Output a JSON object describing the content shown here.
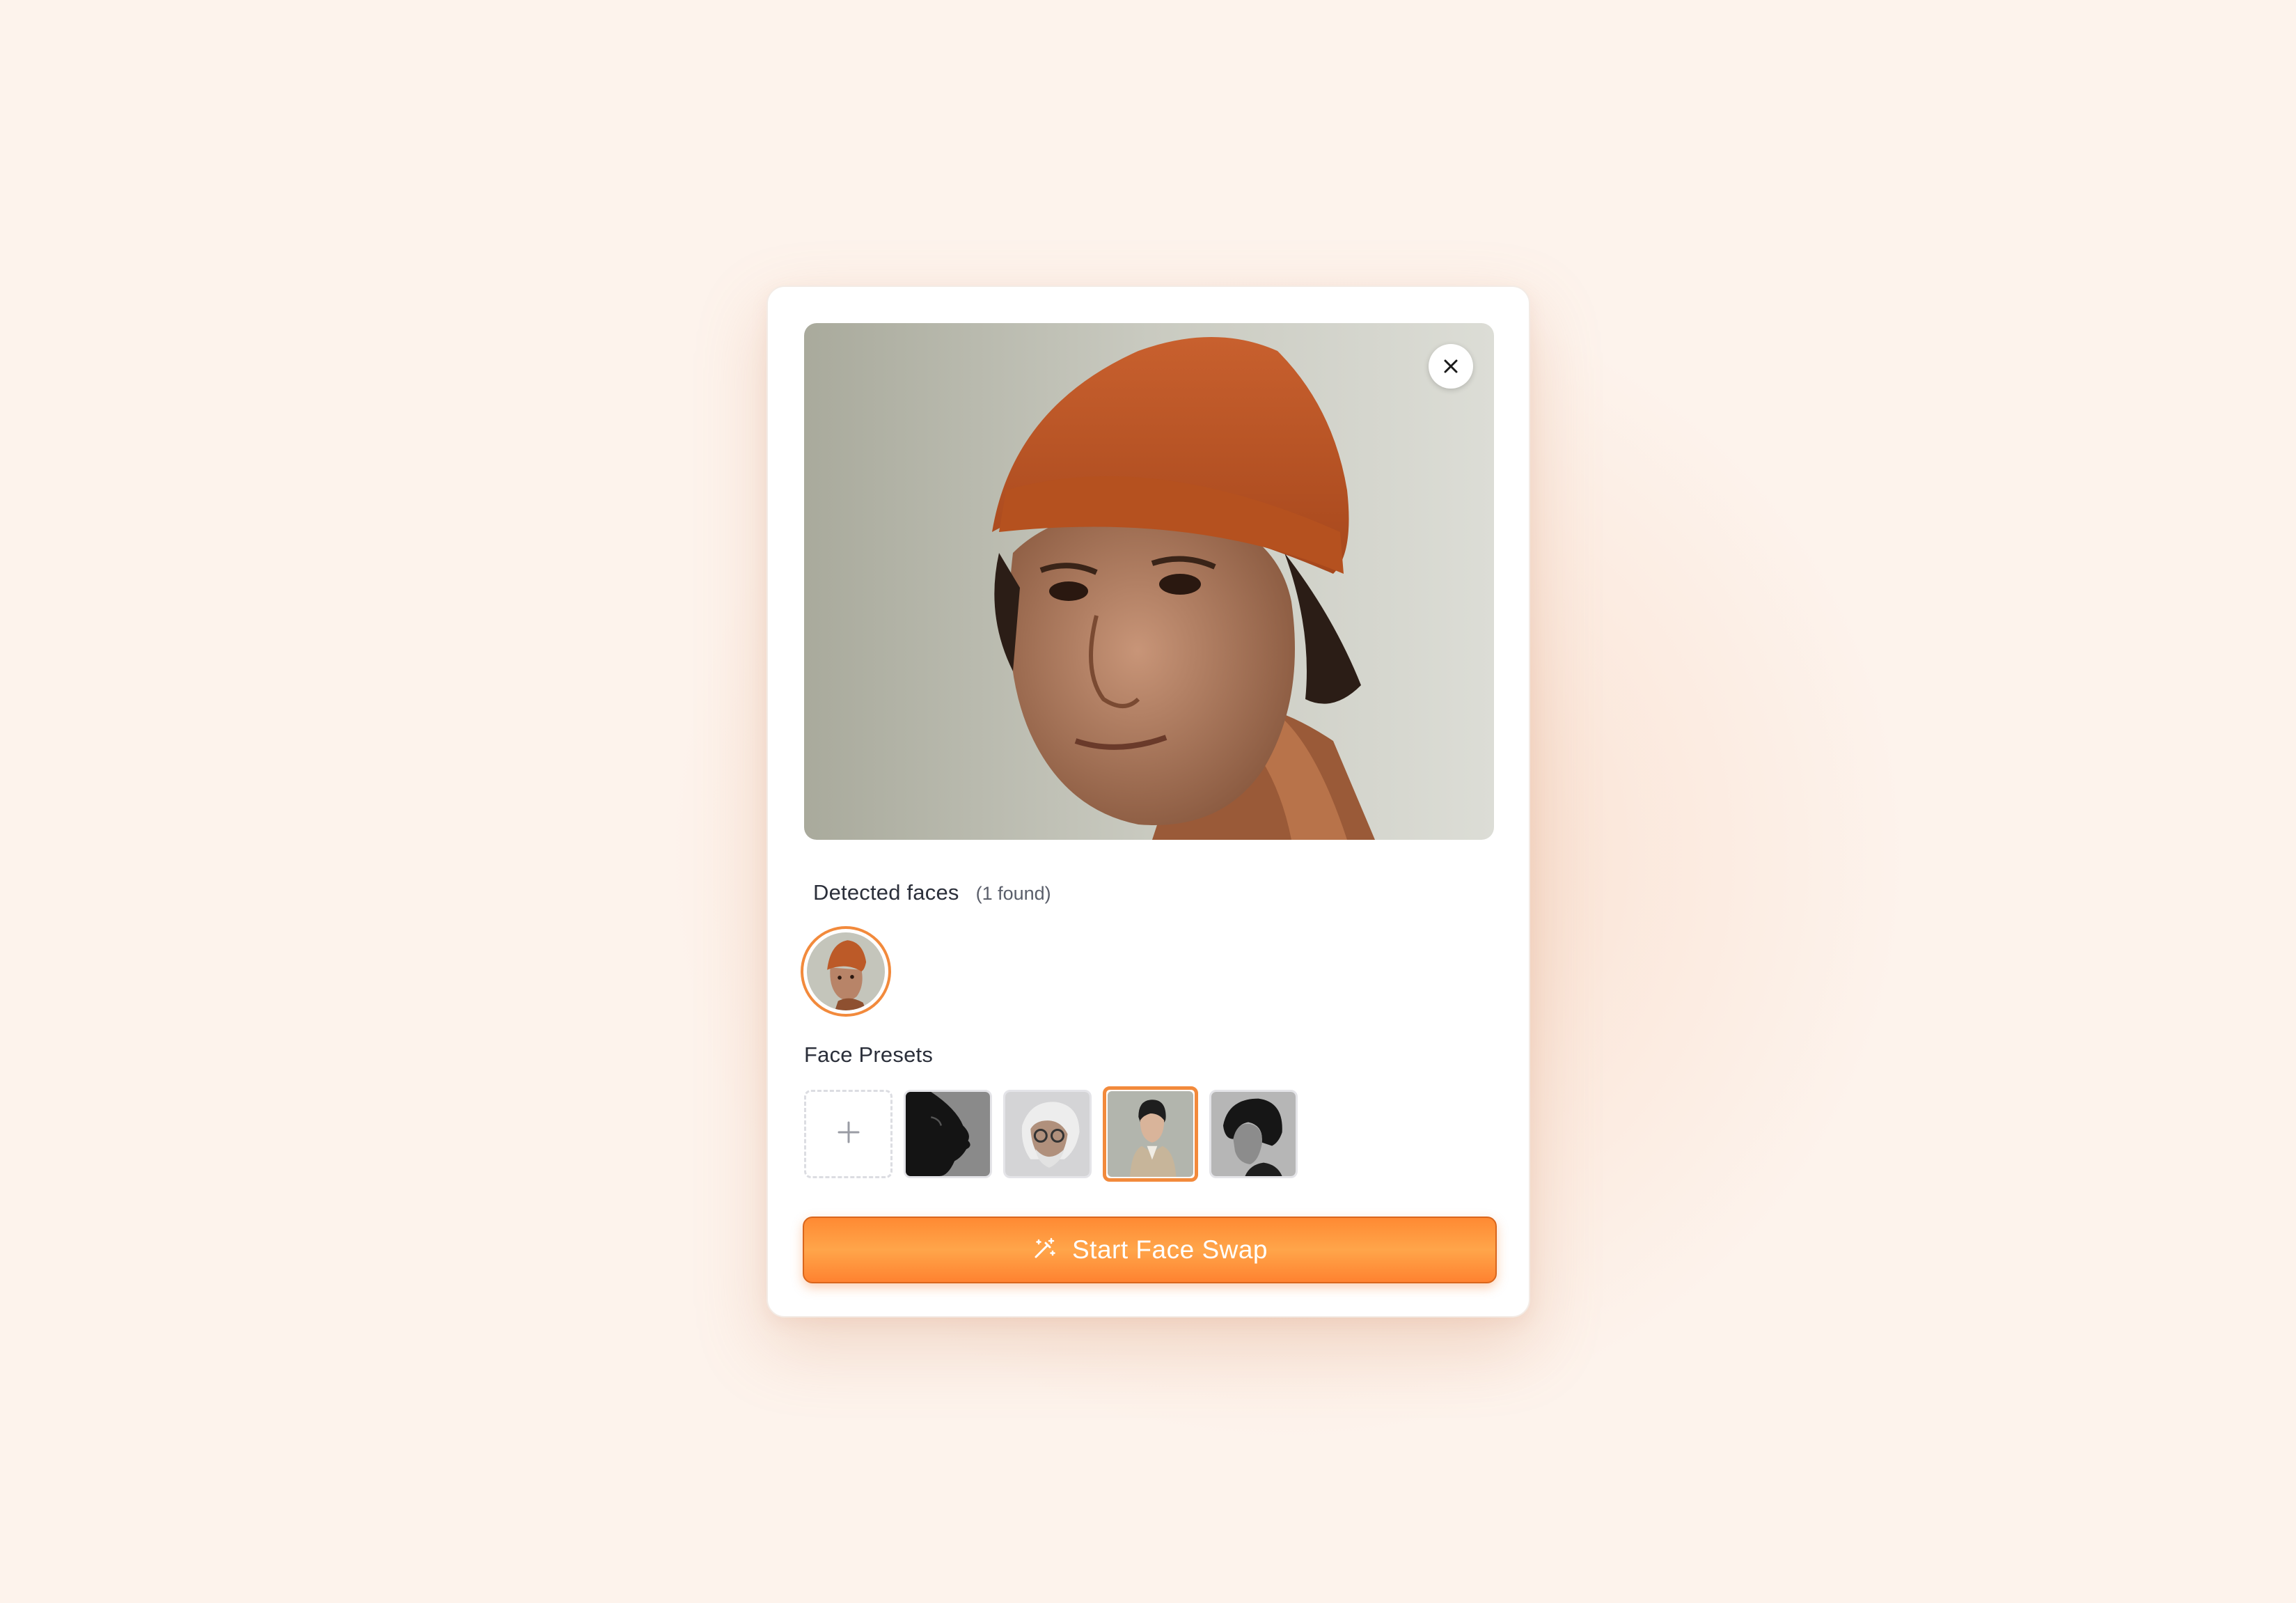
{
  "modal": {
    "close_icon": "close-icon",
    "main_photo_alt": "Portrait of a man wearing an orange beanie"
  },
  "detected_faces": {
    "title": "Detected faces",
    "count_label": "(1 found)"
  },
  "face_presets": {
    "title": "Face Presets",
    "add_icon": "plus-icon",
    "items": [
      {
        "style": "dark profile silhouette"
      },
      {
        "style": "elderly man with glasses"
      },
      {
        "style": "young man in trench coat",
        "selected": true
      },
      {
        "style": "monochrome profile"
      }
    ]
  },
  "action": {
    "start_label": "Start Face Swap",
    "icon": "magic-wand-icon"
  },
  "colors": {
    "accent": "#f28a3c",
    "button": "#ff8a33",
    "background": "#fdf3ec"
  }
}
